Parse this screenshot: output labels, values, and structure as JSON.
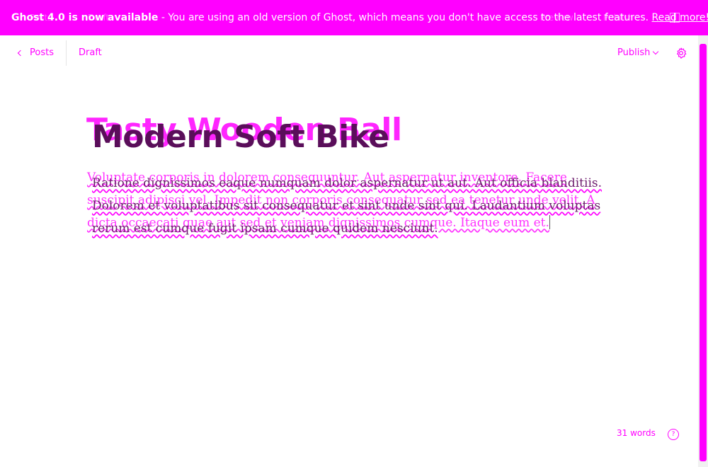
{
  "banner": {
    "title": "Ghost 4.0 is now available",
    "message": " - You are using an old version of Ghost, which means you don't have access to the latest features. ",
    "link": "Read more!",
    "ghost_back": "Posts",
    "ghost_draft": "Draft",
    "ghost_preview": "Preview",
    "ghost_publish": "Publish"
  },
  "toolbar": {
    "back_label": "Posts",
    "status": "Draft",
    "publish_label": "Publish",
    "settings_icon": "gear-icon"
  },
  "editor": {
    "ghost_title": "Tasty Wooden Ball",
    "title": "Modern Soft Bike",
    "body": "Ratione dignissimos eaque numquam dolor aspernatur ut aut. Aut officia blanditiis. Dolorem et voluptatibus sit consequatur et sint unde sint qui. Laudantium voluptas rerum est cumque fugit ipsam cumque quidem nesciunt.",
    "ghost_body": "Voluptate corporis in dolorem consequuntur. Aut aspernatur inventore. Facere suscipit adipisci vel. Impedit non corporis consequatur sed ea tenetur unde velit. A dicta occaecati quae aut sed et veniam dignissimos cumque. Itaque eum et."
  },
  "footer": {
    "word_count": "31 words",
    "help_icon": "question-icon"
  },
  "colors": {
    "accent": "#ff00ff",
    "title": "#5a0e5a"
  }
}
